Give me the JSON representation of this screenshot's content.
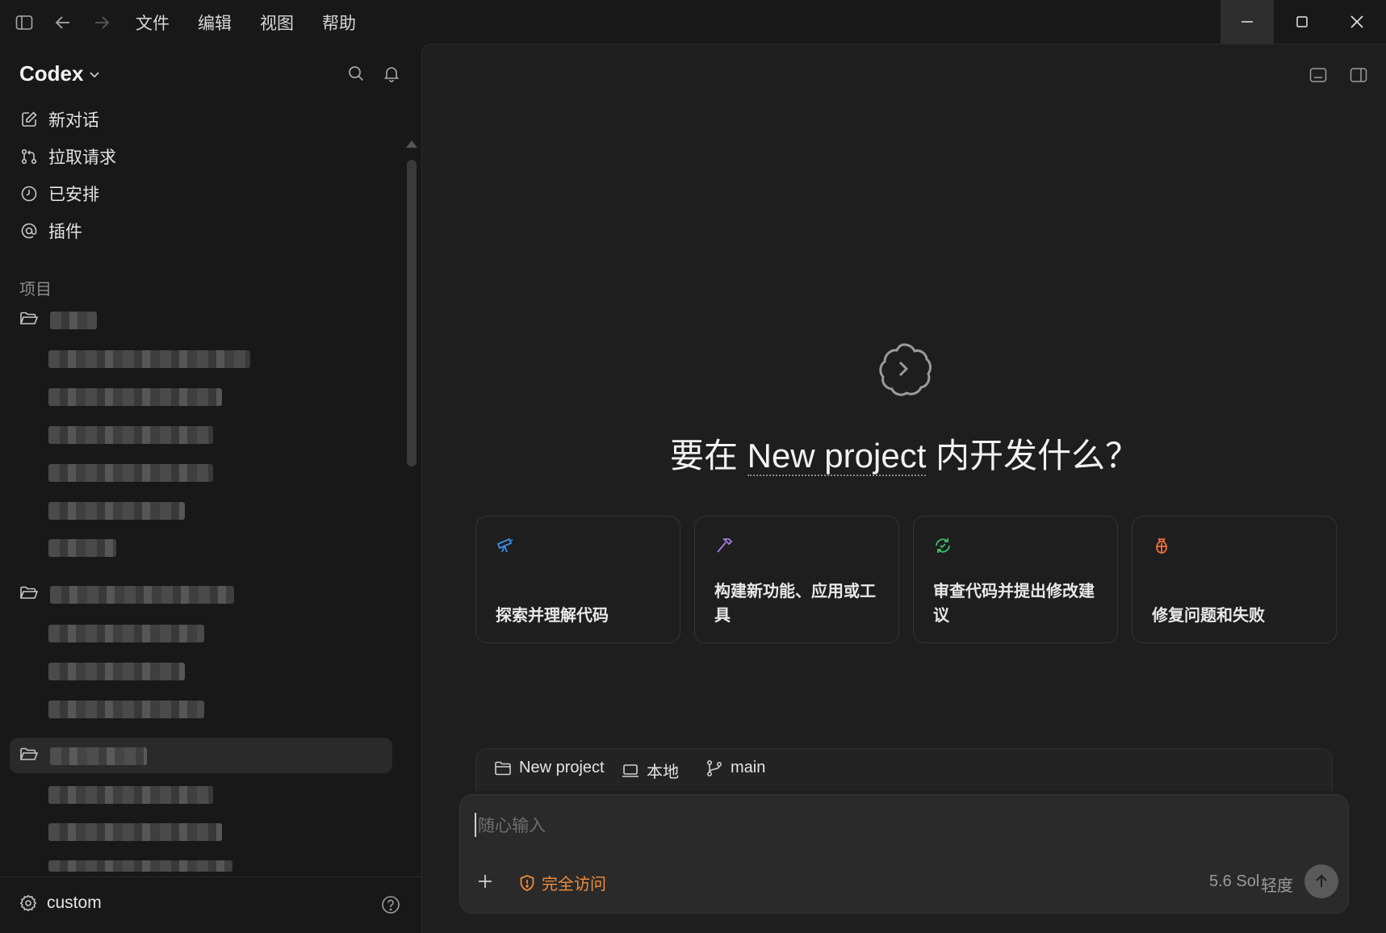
{
  "menu": {
    "file": "文件",
    "edit": "编辑",
    "view": "视图",
    "help": "帮助"
  },
  "sidebar": {
    "brand": "Codex",
    "nav": [
      {
        "label": "新对话",
        "icon": "compose-icon"
      },
      {
        "label": "拉取请求",
        "icon": "pull-request-icon"
      },
      {
        "label": "已安排",
        "icon": "clock-icon"
      },
      {
        "label": "插件",
        "icon": "at-sign-icon"
      }
    ],
    "section_label": "项目",
    "footer_label": "custom"
  },
  "main": {
    "hero_prefix": "要在 ",
    "hero_project": "New project",
    "hero_suffix": " 内开发什么？",
    "cards": [
      {
        "label": "探索并理解代码",
        "icon": "telescope-icon",
        "color": "#3b8fe8"
      },
      {
        "label": "构建新功能、应用或工具",
        "icon": "hammer-icon",
        "color": "#a67be8"
      },
      {
        "label": "审查代码并提出修改建议",
        "icon": "review-cycle-icon",
        "color": "#3fbf6a"
      },
      {
        "label": "修复问题和失败",
        "icon": "bug-icon",
        "color": "#f0703a"
      }
    ],
    "context": {
      "project": "New project",
      "environment": "本地",
      "branch": "main"
    },
    "composer": {
      "placeholder": "随心输入",
      "access": "完全访问",
      "model": "5.6 Sol",
      "effort": "轻度"
    }
  },
  "colors": {
    "accent_orange": "#f08c3a",
    "background": "#181818",
    "panel": "#1e1e1e"
  }
}
